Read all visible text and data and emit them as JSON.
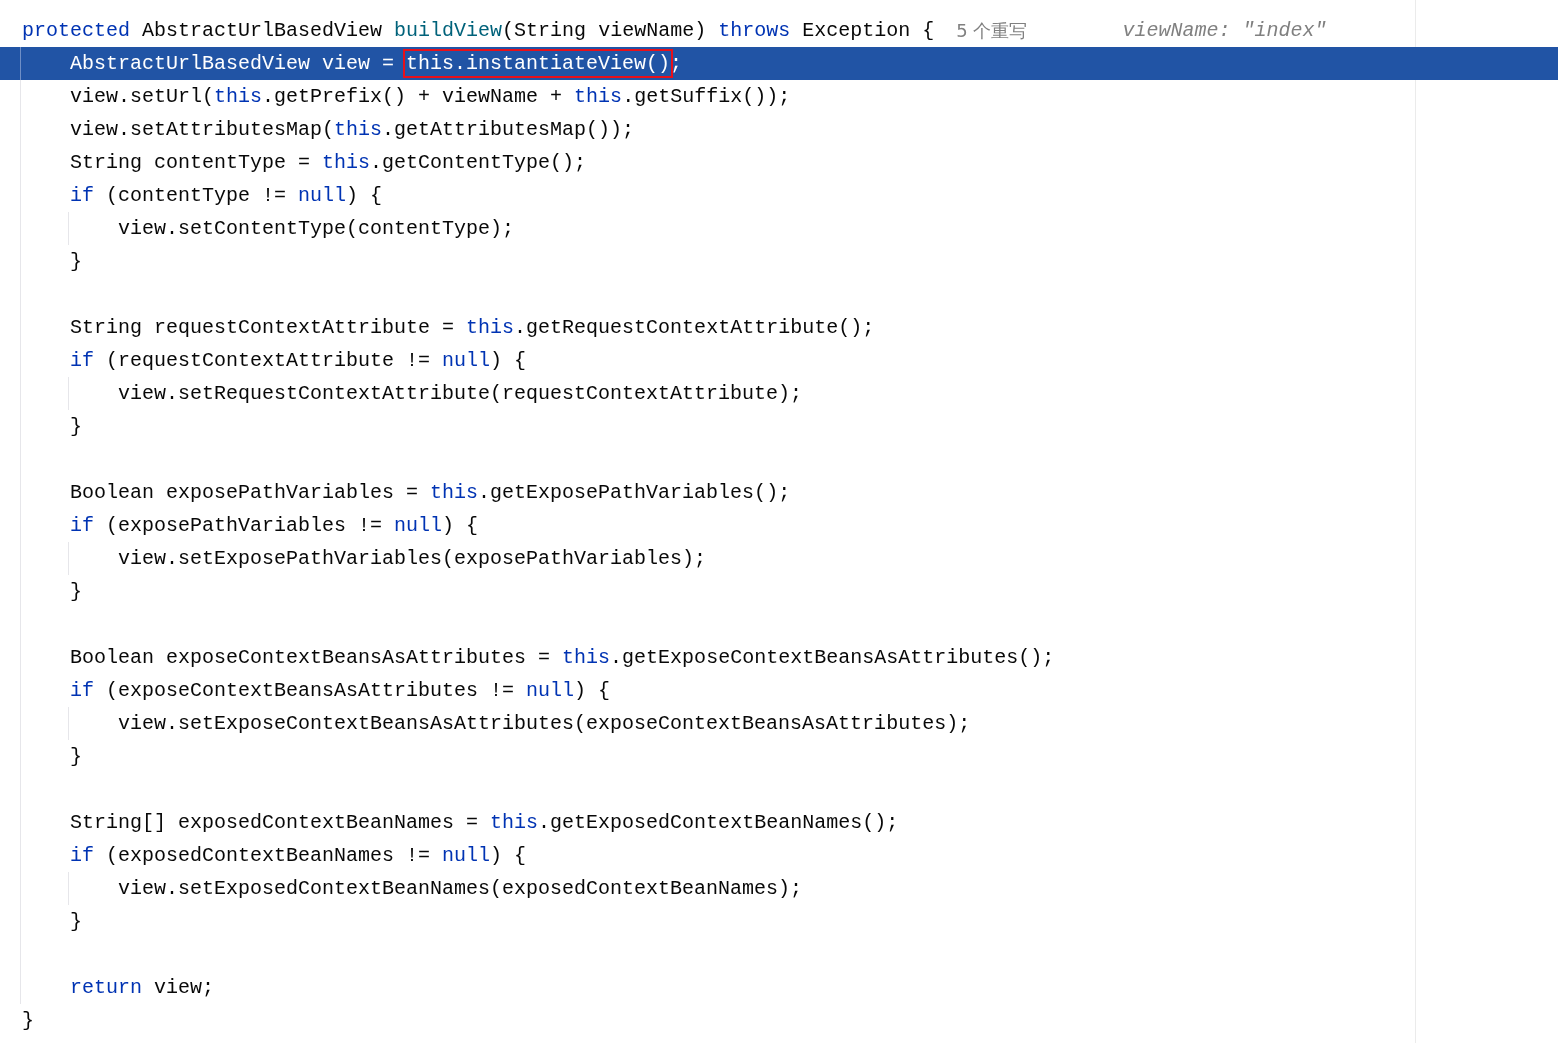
{
  "lines": [
    {
      "kind": "code",
      "selected": false,
      "code": [
        {
          "text": "protected",
          "kind": "keyword"
        },
        {
          "text": " AbstractUrlBasedView ",
          "kind": "plain"
        },
        {
          "text": "buildView",
          "kind": "declaration"
        },
        {
          "text": "(String viewName) ",
          "kind": "plain"
        },
        {
          "text": "throws",
          "kind": "keyword"
        },
        {
          "text": " Exception {",
          "kind": "plain"
        }
      ],
      "hints": [
        {
          "text": "5 个重写",
          "kind": "usages"
        },
        {
          "text": "viewName: \"index\"",
          "kind": "value"
        }
      ],
      "children": [
        {
          "kind": "code",
          "selected": true,
          "code": [
            {
              "text": "AbstractUrlBasedView view = ",
              "kind": "plain"
            },
            {
              "text": "this.instantiateView()",
              "kind": "framed"
            },
            {
              "text": ";",
              "kind": "plain"
            }
          ]
        },
        {
          "kind": "code",
          "selected": false,
          "code": [
            {
              "text": "view.setUrl(",
              "kind": "plain"
            },
            {
              "text": "this",
              "kind": "keyword"
            },
            {
              "text": ".getPrefix() + viewName + ",
              "kind": "plain"
            },
            {
              "text": "this",
              "kind": "keyword"
            },
            {
              "text": ".getSuffix());",
              "kind": "plain"
            }
          ]
        },
        {
          "kind": "code",
          "selected": false,
          "code": [
            {
              "text": "view.setAttributesMap(",
              "kind": "plain"
            },
            {
              "text": "this",
              "kind": "keyword"
            },
            {
              "text": ".getAttributesMap());",
              "kind": "plain"
            }
          ]
        },
        {
          "kind": "code",
          "selected": false,
          "code": [
            {
              "text": "String contentType = ",
              "kind": "plain"
            },
            {
              "text": "this",
              "kind": "keyword"
            },
            {
              "text": ".getContentType();",
              "kind": "plain"
            }
          ]
        },
        {
          "kind": "code",
          "selected": false,
          "code": [
            {
              "text": "if",
              "kind": "keyword"
            },
            {
              "text": " (contentType != ",
              "kind": "plain"
            },
            {
              "text": "null",
              "kind": "keyword"
            },
            {
              "text": ") {",
              "kind": "plain"
            }
          ],
          "children": [
            {
              "kind": "code",
              "selected": false,
              "code": [
                {
                  "text": "view.setContentType(contentType);",
                  "kind": "plain"
                }
              ]
            }
          ]
        },
        {
          "kind": "code",
          "selected": false,
          "code": [
            {
              "text": "}",
              "kind": "plain"
            }
          ]
        },
        {
          "kind": "blank"
        },
        {
          "kind": "code",
          "selected": false,
          "code": [
            {
              "text": "String requestContextAttribute = ",
              "kind": "plain"
            },
            {
              "text": "this",
              "kind": "keyword"
            },
            {
              "text": ".getRequestContextAttribute();",
              "kind": "plain"
            }
          ]
        },
        {
          "kind": "code",
          "selected": false,
          "code": [
            {
              "text": "if",
              "kind": "keyword"
            },
            {
              "text": " (requestContextAttribute != ",
              "kind": "plain"
            },
            {
              "text": "null",
              "kind": "keyword"
            },
            {
              "text": ") {",
              "kind": "plain"
            }
          ],
          "children": [
            {
              "kind": "code",
              "selected": false,
              "code": [
                {
                  "text": "view.setRequestContextAttribute(requestContextAttribute);",
                  "kind": "plain"
                }
              ]
            }
          ]
        },
        {
          "kind": "code",
          "selected": false,
          "code": [
            {
              "text": "}",
              "kind": "plain"
            }
          ]
        },
        {
          "kind": "blank"
        },
        {
          "kind": "code",
          "selected": false,
          "code": [
            {
              "text": "Boolean exposePathVariables = ",
              "kind": "plain"
            },
            {
              "text": "this",
              "kind": "keyword"
            },
            {
              "text": ".getExposePathVariables();",
              "kind": "plain"
            }
          ]
        },
        {
          "kind": "code",
          "selected": false,
          "code": [
            {
              "text": "if",
              "kind": "keyword"
            },
            {
              "text": " (exposePathVariables != ",
              "kind": "plain"
            },
            {
              "text": "null",
              "kind": "keyword"
            },
            {
              "text": ") {",
              "kind": "plain"
            }
          ],
          "children": [
            {
              "kind": "code",
              "selected": false,
              "code": [
                {
                  "text": "view.setExposePathVariables(exposePathVariables);",
                  "kind": "plain"
                }
              ]
            }
          ]
        },
        {
          "kind": "code",
          "selected": false,
          "code": [
            {
              "text": "}",
              "kind": "plain"
            }
          ]
        },
        {
          "kind": "blank"
        },
        {
          "kind": "code",
          "selected": false,
          "code": [
            {
              "text": "Boolean exposeContextBeansAsAttributes = ",
              "kind": "plain"
            },
            {
              "text": "this",
              "kind": "keyword"
            },
            {
              "text": ".getExposeContextBeansAsAttributes();",
              "kind": "plain"
            }
          ]
        },
        {
          "kind": "code",
          "selected": false,
          "code": [
            {
              "text": "if",
              "kind": "keyword"
            },
            {
              "text": " (exposeContextBeansAsAttributes != ",
              "kind": "plain"
            },
            {
              "text": "null",
              "kind": "keyword"
            },
            {
              "text": ") {",
              "kind": "plain"
            }
          ],
          "children": [
            {
              "kind": "code",
              "selected": false,
              "code": [
                {
                  "text": "view.setExposeContextBeansAsAttributes(exposeContextBeansAsAttributes);",
                  "kind": "plain"
                }
              ]
            }
          ]
        },
        {
          "kind": "code",
          "selected": false,
          "code": [
            {
              "text": "}",
              "kind": "plain"
            }
          ]
        },
        {
          "kind": "blank"
        },
        {
          "kind": "code",
          "selected": false,
          "code": [
            {
              "text": "String[] exposedContextBeanNames = ",
              "kind": "plain"
            },
            {
              "text": "this",
              "kind": "keyword"
            },
            {
              "text": ".getExposedContextBeanNames();",
              "kind": "plain"
            }
          ]
        },
        {
          "kind": "code",
          "selected": false,
          "code": [
            {
              "text": "if",
              "kind": "keyword"
            },
            {
              "text": " (exposedContextBeanNames != ",
              "kind": "plain"
            },
            {
              "text": "null",
              "kind": "keyword"
            },
            {
              "text": ") {",
              "kind": "plain"
            }
          ],
          "children": [
            {
              "kind": "code",
              "selected": false,
              "code": [
                {
                  "text": "view.setExposedContextBeanNames(exposedContextBeanNames);",
                  "kind": "plain"
                }
              ]
            }
          ]
        },
        {
          "kind": "code",
          "selected": false,
          "code": [
            {
              "text": "}",
              "kind": "plain"
            }
          ]
        },
        {
          "kind": "blank"
        },
        {
          "kind": "code",
          "selected": false,
          "code": [
            {
              "text": "return",
              "kind": "keyword"
            },
            {
              "text": " view;",
              "kind": "plain"
            }
          ]
        }
      ]
    },
    {
      "kind": "code",
      "selected": false,
      "code": [
        {
          "text": "}",
          "kind": "plain"
        }
      ]
    }
  ]
}
